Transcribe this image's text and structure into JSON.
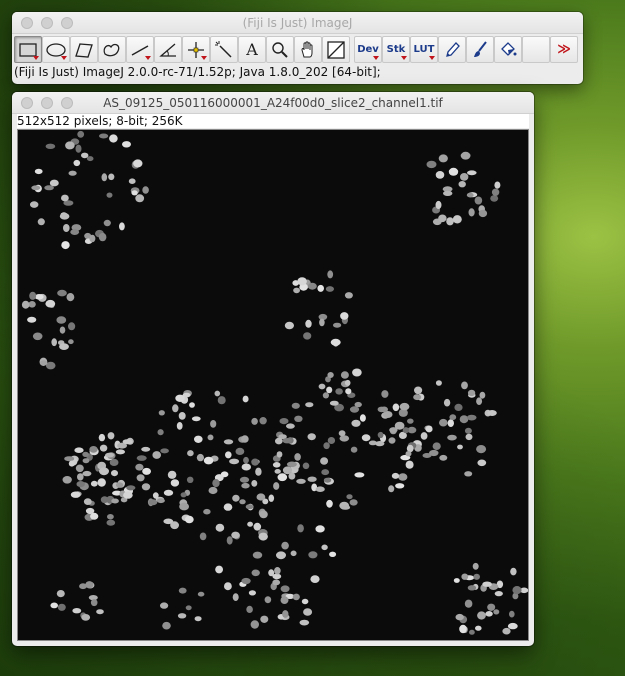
{
  "toolbar_window": {
    "title": "(Fiji Is Just) ImageJ",
    "status": "(Fiji Is Just) ImageJ 2.0.0-rc-71/1.52p; Java 1.8.0_202 [64-bit];",
    "tools": [
      {
        "name": "rectangle-icon",
        "active": true,
        "caret": true
      },
      {
        "name": "oval-icon",
        "caret": true
      },
      {
        "name": "polygon-icon"
      },
      {
        "name": "freehand-icon"
      },
      {
        "name": "line-icon",
        "caret": true
      },
      {
        "name": "angle-icon"
      },
      {
        "name": "point-icon",
        "caret": true
      },
      {
        "name": "wand-icon"
      },
      {
        "name": "text-icon"
      },
      {
        "name": "magnifier-icon"
      },
      {
        "name": "hand-icon"
      },
      {
        "name": "color-picker-icon"
      },
      {
        "label": "Dev",
        "caret": true
      },
      {
        "label": "Stk",
        "caret": true
      },
      {
        "label": "LUT",
        "caret": true
      },
      {
        "name": "pencil-icon"
      },
      {
        "name": "brush-icon"
      },
      {
        "name": "flood-fill-icon"
      },
      {
        "name": "empty-slot"
      },
      {
        "label": "≫"
      }
    ]
  },
  "image_window": {
    "title": "AS_09125_050116000001_A24f00d0_slice2_channel1.tif",
    "info": "512x512 pixels; 8-bit; 256K"
  },
  "colors": {
    "window_bg": "#ececec",
    "accent_red": "#c0141a",
    "tool_text_blue": "#1c3b8a",
    "image_bg": "#0b0b0b"
  }
}
